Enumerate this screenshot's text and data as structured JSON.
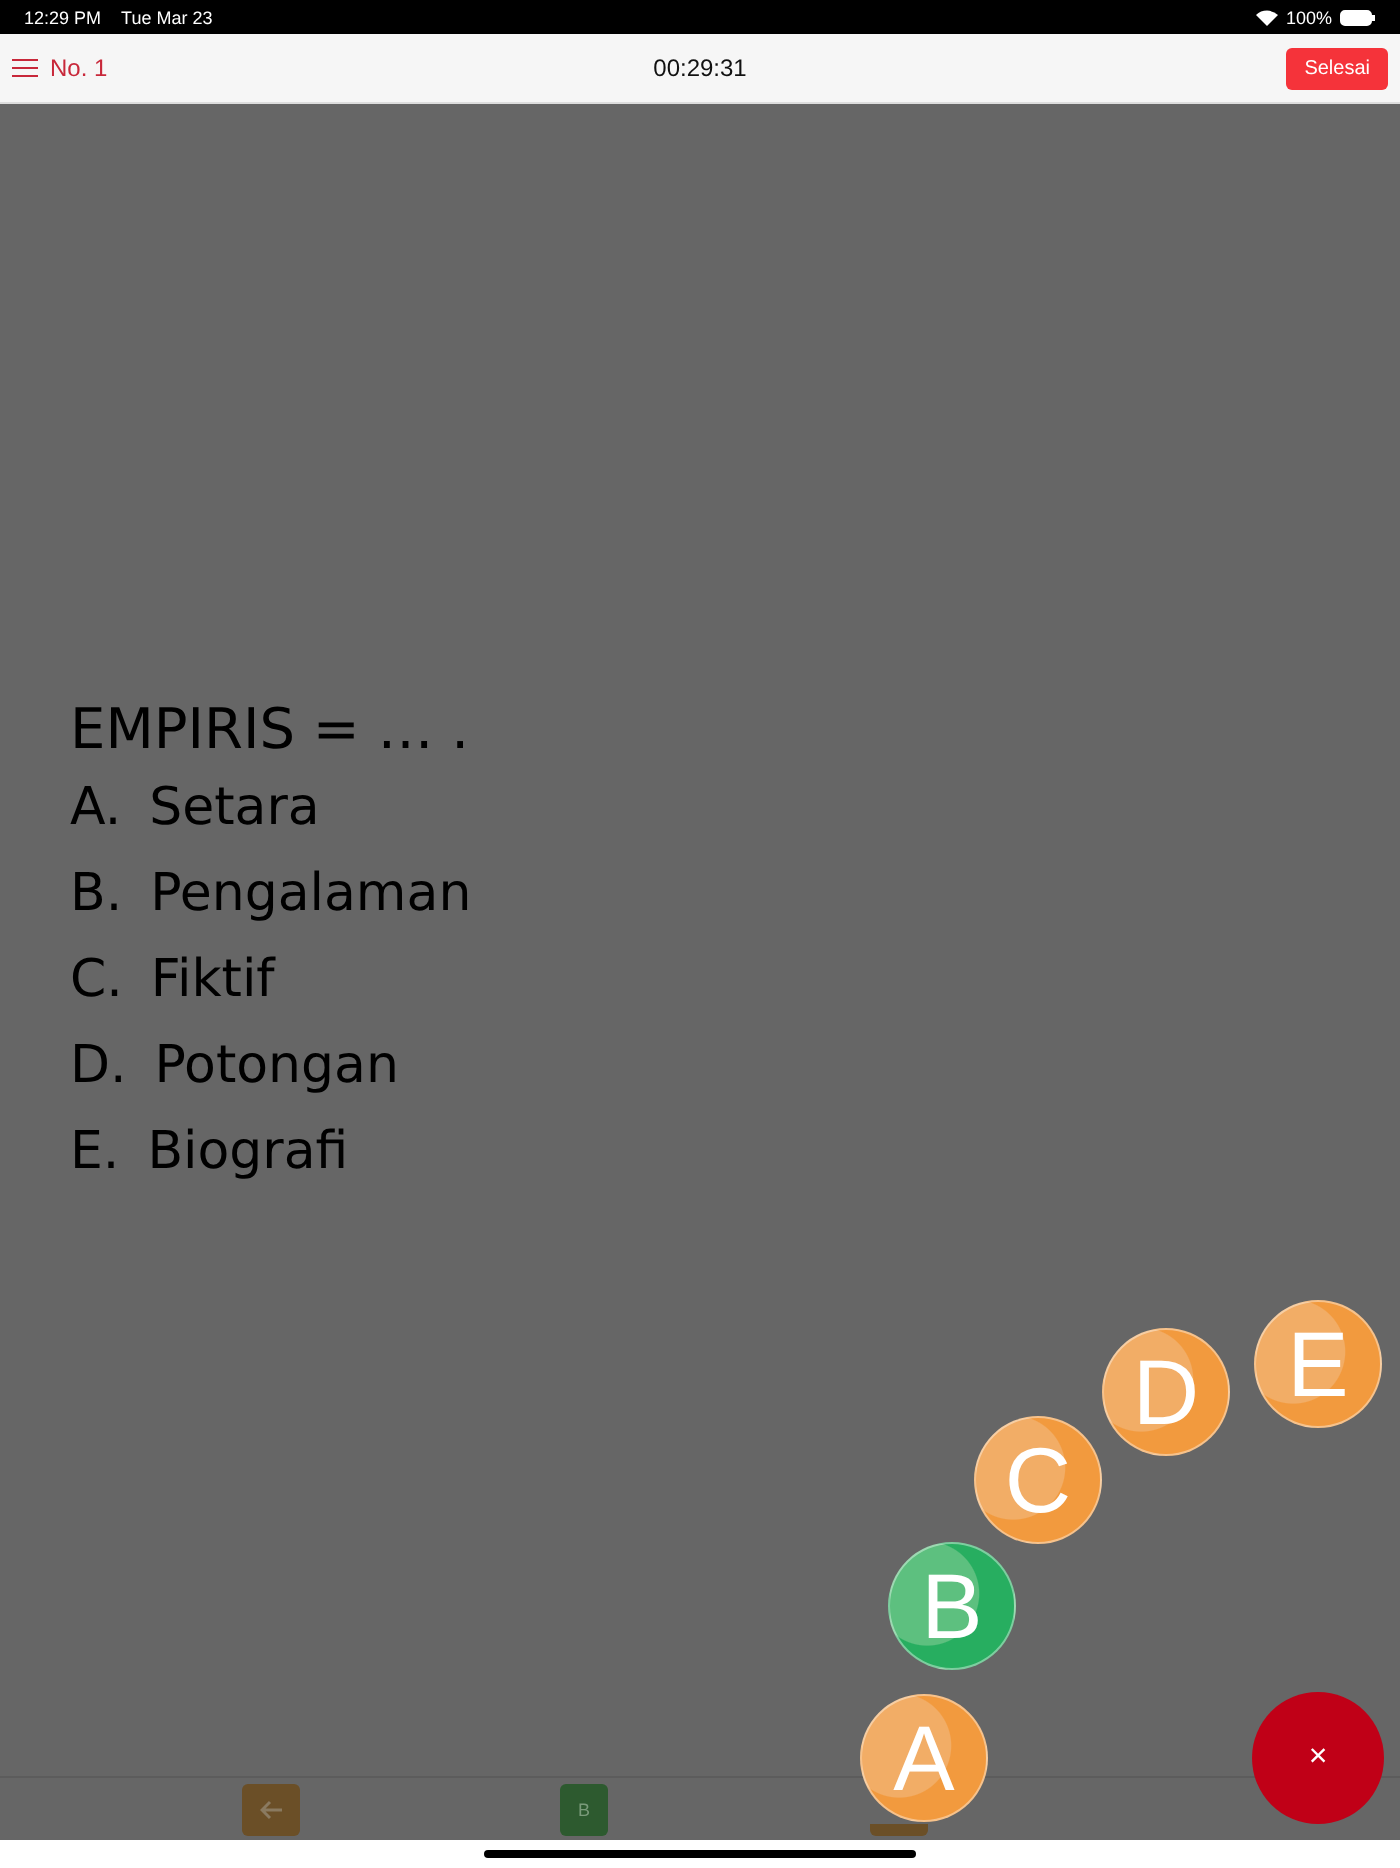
{
  "status_bar": {
    "time": "12:29 PM",
    "date": "Tue Mar 23",
    "battery": "100%"
  },
  "header": {
    "number": "No. 1",
    "timer": "00:29:31",
    "finish_button": "Selesai"
  },
  "question": {
    "stem": "EMPIRIS = … .",
    "options": [
      {
        "letter": "A.",
        "text": "Setara"
      },
      {
        "letter": "B.",
        "text": "Pengalaman"
      },
      {
        "letter": "C.",
        "text": "Fiktif"
      },
      {
        "letter": "D.",
        "text": "Potongan"
      },
      {
        "letter": "E.",
        "text": "Biografi"
      }
    ]
  },
  "bottom_bar": {
    "answer_badge": "B"
  },
  "answer_menu": {
    "close": "×",
    "choices": [
      {
        "letter": "A",
        "selected": false
      },
      {
        "letter": "B",
        "selected": true
      },
      {
        "letter": "C",
        "selected": false
      },
      {
        "letter": "D",
        "selected": false
      },
      {
        "letter": "E",
        "selected": false
      }
    ]
  }
}
